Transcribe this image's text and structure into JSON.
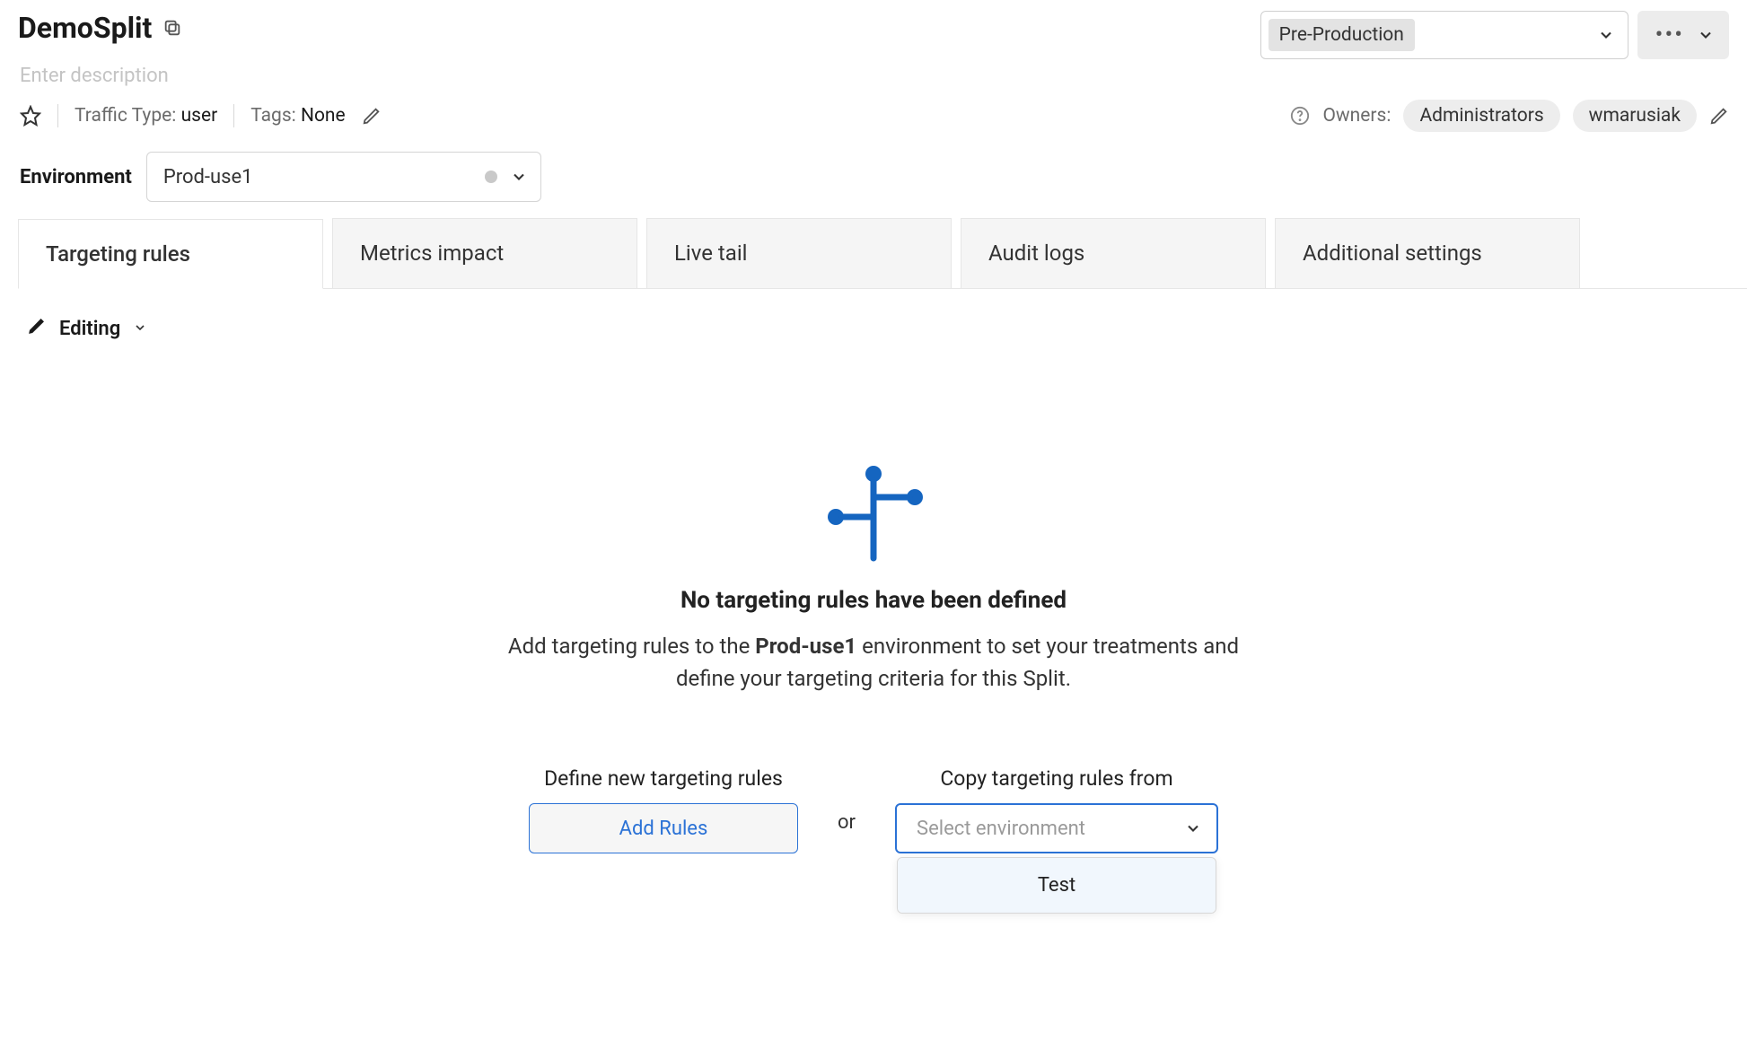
{
  "header": {
    "title": "DemoSplit",
    "description_placeholder": "Enter description",
    "topEnvSelector": "Pre-Production"
  },
  "meta": {
    "trafficTypeLabel": "Traffic Type: ",
    "trafficTypeValue": "user",
    "tagsLabel": "Tags: ",
    "tagsValue": "None",
    "ownersLabel": "Owners:",
    "owners": [
      "Administrators",
      "wmarusiak"
    ]
  },
  "environment": {
    "label": "Environment",
    "selected": "Prod-use1"
  },
  "tabs": [
    {
      "label": "Targeting rules",
      "active": true
    },
    {
      "label": "Metrics impact",
      "active": false
    },
    {
      "label": "Live tail",
      "active": false
    },
    {
      "label": "Audit logs",
      "active": false
    },
    {
      "label": "Additional settings",
      "active": false
    }
  ],
  "editing": {
    "label": "Editing"
  },
  "emptyState": {
    "title": "No targeting rules have been defined",
    "sub_pre": "Add targeting rules to the ",
    "sub_bold": "Prod-use1",
    "sub_post": " environment to set your treatments and define your targeting criteria for this Split."
  },
  "actions": {
    "defineLabel": "Define new targeting rules",
    "addRulesButton": "Add Rules",
    "orText": "or",
    "copyLabel": "Copy targeting rules from",
    "selectPlaceholder": "Select environment",
    "dropdownOptions": [
      "Test"
    ]
  }
}
